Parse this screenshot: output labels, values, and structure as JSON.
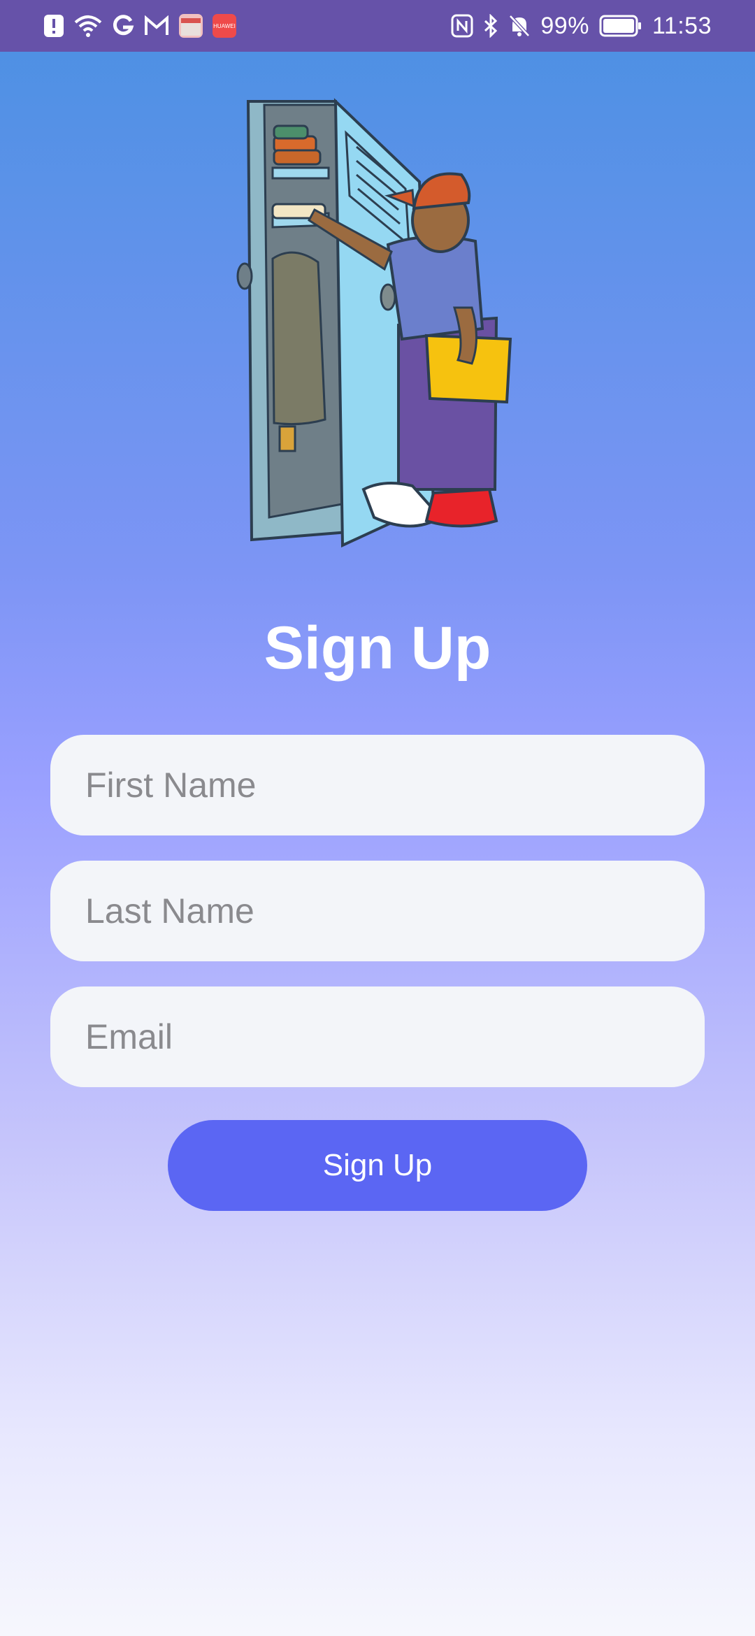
{
  "status_bar": {
    "battery_percent": "99%",
    "time": "11:53",
    "icons_left": [
      "alert-icon",
      "wifi-icon",
      "google-icon",
      "gmail-icon",
      "app-box-icon",
      "huawei-store-icon"
    ],
    "icons_right": [
      "nfc-icon",
      "bluetooth-icon",
      "mute-bell-icon",
      "battery-icon"
    ],
    "huawei_badge_text": "HUAWEI"
  },
  "colors": {
    "status_bar_bg": "#6652a9",
    "button_bg": "#5b66f3",
    "field_bg": "#f3f5f9",
    "title_color": "#ffffff"
  },
  "signup": {
    "title": "Sign Up",
    "first_name": {
      "placeholder": "First Name",
      "value": ""
    },
    "last_name": {
      "placeholder": "Last Name",
      "value": ""
    },
    "email": {
      "placeholder": "Email",
      "value": ""
    },
    "button_label": "Sign Up"
  },
  "illustration": {
    "name": "student-at-locker-illustration"
  }
}
